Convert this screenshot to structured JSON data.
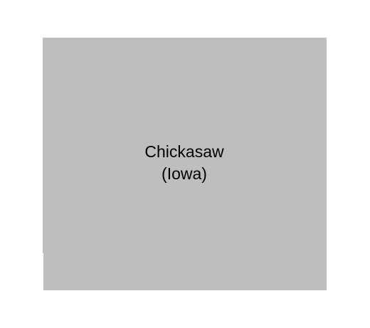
{
  "map": {
    "county_name": "Chickasaw",
    "state_label": "(Iowa)",
    "fill_color": "#bebebe",
    "background_color": "#ffffff",
    "text_color": "#000000"
  }
}
